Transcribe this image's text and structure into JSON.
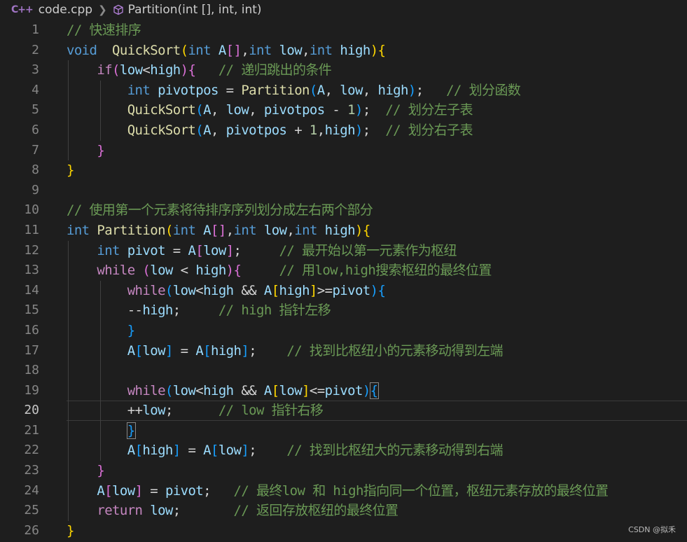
{
  "breadcrumb": {
    "file_icon": "C++",
    "file": "code.cpp",
    "symbol": "Partition(int [], int, int)"
  },
  "editor": {
    "lines": [
      {
        "n": "1",
        "tokens": [
          [
            "cm",
            "// 快速排序"
          ]
        ]
      },
      {
        "n": "2",
        "tokens": [
          [
            "kw",
            "void"
          ],
          [
            "",
            "  "
          ],
          [
            "fn",
            "QuickSort"
          ],
          [
            "b1",
            "("
          ],
          [
            "kw",
            "int"
          ],
          [
            "",
            " "
          ],
          [
            "var",
            "A"
          ],
          [
            "b2",
            "[]"
          ],
          [
            "",
            ","
          ],
          [
            "kw",
            "int"
          ],
          [
            "",
            " "
          ],
          [
            "var",
            "low"
          ],
          [
            "",
            ","
          ],
          [
            "kw",
            "int"
          ],
          [
            "",
            " "
          ],
          [
            "var",
            "high"
          ],
          [
            "b1",
            ")"
          ],
          [
            "b1",
            "{"
          ]
        ]
      },
      {
        "n": "3",
        "tokens": [
          [
            "",
            "    "
          ],
          [
            "ctl",
            "if"
          ],
          [
            "b2",
            "("
          ],
          [
            "var",
            "low"
          ],
          [
            "",
            "<"
          ],
          [
            "var",
            "high"
          ],
          [
            "b2",
            ")"
          ],
          [
            "b2",
            "{"
          ],
          [
            "",
            "   "
          ],
          [
            "cm",
            "// 递归跳出的条件"
          ]
        ]
      },
      {
        "n": "4",
        "tokens": [
          [
            "",
            "        "
          ],
          [
            "kw",
            "int"
          ],
          [
            "",
            " "
          ],
          [
            "var",
            "pivotpos"
          ],
          [
            "",
            " = "
          ],
          [
            "fn",
            "Partition"
          ],
          [
            "b3",
            "("
          ],
          [
            "var",
            "A"
          ],
          [
            ", "
          ],
          [
            "var",
            "low"
          ],
          [
            ", "
          ],
          [
            "var",
            "high"
          ],
          [
            "b3",
            ")"
          ],
          [
            ";   "
          ],
          [
            "cm",
            "// 划分函数"
          ]
        ]
      },
      {
        "n": "5",
        "tokens": [
          [
            "",
            "        "
          ],
          [
            "fn",
            "QuickSort"
          ],
          [
            "b3",
            "("
          ],
          [
            "var",
            "A"
          ],
          [
            ", "
          ],
          [
            "var",
            "low"
          ],
          [
            ", "
          ],
          [
            "var",
            "pivotpos"
          ],
          [
            "",
            " - "
          ],
          [
            "num",
            "1"
          ],
          [
            "b3",
            ")"
          ],
          [
            ";  "
          ],
          [
            "cm",
            "// 划分左子表"
          ]
        ]
      },
      {
        "n": "6",
        "tokens": [
          [
            "",
            "        "
          ],
          [
            "fn",
            "QuickSort"
          ],
          [
            "b3",
            "("
          ],
          [
            "var",
            "A"
          ],
          [
            ", "
          ],
          [
            "var",
            "pivotpos"
          ],
          [
            "",
            " + "
          ],
          [
            "num",
            "1"
          ],
          [
            ","
          ],
          [
            "var",
            "high"
          ],
          [
            "b3",
            ")"
          ],
          [
            ";  "
          ],
          [
            "cm",
            "// 划分右子表"
          ]
        ]
      },
      {
        "n": "7",
        "tokens": [
          [
            "",
            "    "
          ],
          [
            "b2",
            "}"
          ]
        ]
      },
      {
        "n": "8",
        "tokens": [
          [
            "b1",
            "}"
          ]
        ]
      },
      {
        "n": "9",
        "tokens": []
      },
      {
        "n": "10",
        "tokens": [
          [
            "cm",
            "// 使用第一个元素将待排序序列划分成左右两个部分"
          ]
        ]
      },
      {
        "n": "11",
        "tokens": [
          [
            "kw",
            "int"
          ],
          [
            "",
            " "
          ],
          [
            "fn",
            "Partition"
          ],
          [
            "b1",
            "("
          ],
          [
            "kw",
            "int"
          ],
          [
            "",
            " "
          ],
          [
            "var",
            "A"
          ],
          [
            "b2",
            "[]"
          ],
          [
            "",
            ","
          ],
          [
            "kw",
            "int"
          ],
          [
            "",
            " "
          ],
          [
            "var",
            "low"
          ],
          [
            "",
            ","
          ],
          [
            "kw",
            "int"
          ],
          [
            "",
            " "
          ],
          [
            "var",
            "high"
          ],
          [
            "b1",
            ")"
          ],
          [
            "b1",
            "{"
          ]
        ]
      },
      {
        "n": "12",
        "tokens": [
          [
            "",
            "    "
          ],
          [
            "kw",
            "int"
          ],
          [
            "",
            " "
          ],
          [
            "var",
            "pivot"
          ],
          [
            "",
            " = "
          ],
          [
            "var",
            "A"
          ],
          [
            "b2",
            "["
          ],
          [
            "var",
            "low"
          ],
          [
            "b2",
            "]"
          ],
          [
            ";     "
          ],
          [
            "cm",
            "// 最开始以第一元素作为枢纽"
          ]
        ]
      },
      {
        "n": "13",
        "tokens": [
          [
            "",
            "    "
          ],
          [
            "ctl",
            "while"
          ],
          [
            "",
            " "
          ],
          [
            "b2",
            "("
          ],
          [
            "var",
            "low"
          ],
          [
            "",
            " < "
          ],
          [
            "var",
            "high"
          ],
          [
            "b2",
            ")"
          ],
          [
            "b2",
            "{"
          ],
          [
            "",
            "     "
          ],
          [
            "cm",
            "// 用low,high搜索枢纽的最终位置"
          ]
        ]
      },
      {
        "n": "14",
        "tokens": [
          [
            "",
            "        "
          ],
          [
            "ctl",
            "while"
          ],
          [
            "b3",
            "("
          ],
          [
            "var",
            "low"
          ],
          [
            "",
            "<"
          ],
          [
            "var",
            "high"
          ],
          [
            "",
            " && "
          ],
          [
            "var",
            "A"
          ],
          [
            "b1",
            "["
          ],
          [
            "var",
            "high"
          ],
          [
            "b1",
            "]"
          ],
          [
            ">="
          ],
          [
            "var",
            "pivot"
          ],
          [
            "b3",
            ")"
          ],
          [
            "b3",
            "{"
          ]
        ]
      },
      {
        "n": "15",
        "tokens": [
          [
            "",
            "        "
          ],
          [
            "",
            "--"
          ],
          [
            "var",
            "high"
          ],
          [
            ";     "
          ],
          [
            "cm",
            "// high 指针左移"
          ]
        ]
      },
      {
        "n": "16",
        "tokens": [
          [
            "",
            "        "
          ],
          [
            "b3",
            "}"
          ]
        ]
      },
      {
        "n": "17",
        "tokens": [
          [
            "",
            "        "
          ],
          [
            "var",
            "A"
          ],
          [
            "b3",
            "["
          ],
          [
            "var",
            "low"
          ],
          [
            "b3",
            "]"
          ],
          [
            "",
            " = "
          ],
          [
            "var",
            "A"
          ],
          [
            "b3",
            "["
          ],
          [
            "var",
            "high"
          ],
          [
            "b3",
            "]"
          ],
          [
            ";    "
          ],
          [
            "cm",
            "// 找到比枢纽小的元素移动得到左端"
          ]
        ]
      },
      {
        "n": "18",
        "tokens": []
      },
      {
        "n": "19",
        "tokens": [
          [
            "",
            "        "
          ],
          [
            "ctl",
            "while"
          ],
          [
            "b3",
            "("
          ],
          [
            "var",
            "low"
          ],
          [
            "",
            "<"
          ],
          [
            "var",
            "high"
          ],
          [
            "",
            " && "
          ],
          [
            "var",
            "A"
          ],
          [
            "b1",
            "["
          ],
          [
            "var",
            "low"
          ],
          [
            "b1",
            "]"
          ],
          [
            "<="
          ],
          [
            "var",
            "pivot"
          ],
          [
            "b3",
            ")"
          ],
          [
            "b3 bm",
            "{"
          ]
        ]
      },
      {
        "n": "20",
        "tokens": [
          [
            "",
            "        "
          ],
          [
            "",
            "++"
          ],
          [
            "var",
            "low"
          ],
          [
            ";      "
          ],
          [
            "cm",
            "// low 指针右移"
          ]
        ]
      },
      {
        "n": "21",
        "tokens": [
          [
            "",
            "        "
          ],
          [
            "b3 bm",
            "}"
          ]
        ]
      },
      {
        "n": "22",
        "tokens": [
          [
            "",
            "        "
          ],
          [
            "var",
            "A"
          ],
          [
            "b3",
            "["
          ],
          [
            "var",
            "high"
          ],
          [
            "b3",
            "]"
          ],
          [
            "",
            " = "
          ],
          [
            "var",
            "A"
          ],
          [
            "b3",
            "["
          ],
          [
            "var",
            "low"
          ],
          [
            "b3",
            "]"
          ],
          [
            ";    "
          ],
          [
            "cm",
            "// 找到比枢纽大的元素移动得到右端"
          ]
        ]
      },
      {
        "n": "23",
        "tokens": [
          [
            "",
            "    "
          ],
          [
            "b2",
            "}"
          ]
        ]
      },
      {
        "n": "24",
        "tokens": [
          [
            "",
            "    "
          ],
          [
            "var",
            "A"
          ],
          [
            "b2",
            "["
          ],
          [
            "var",
            "low"
          ],
          [
            "b2",
            "]"
          ],
          [
            "",
            " = "
          ],
          [
            "var",
            "pivot"
          ],
          [
            ";   "
          ],
          [
            "cm",
            "// 最终low 和 high指向同一个位置，枢纽元素存放的最终位置"
          ]
        ]
      },
      {
        "n": "25",
        "tokens": [
          [
            "",
            "    "
          ],
          [
            "ctl",
            "return"
          ],
          [
            "",
            " "
          ],
          [
            "var",
            "low"
          ],
          [
            ";       "
          ],
          [
            "cm",
            "// 返回存放枢纽的最终位置"
          ]
        ]
      },
      {
        "n": "26",
        "tokens": [
          [
            "b1",
            "}"
          ]
        ]
      }
    ],
    "active_line": "20"
  },
  "watermark": "CSDN @拟禾"
}
